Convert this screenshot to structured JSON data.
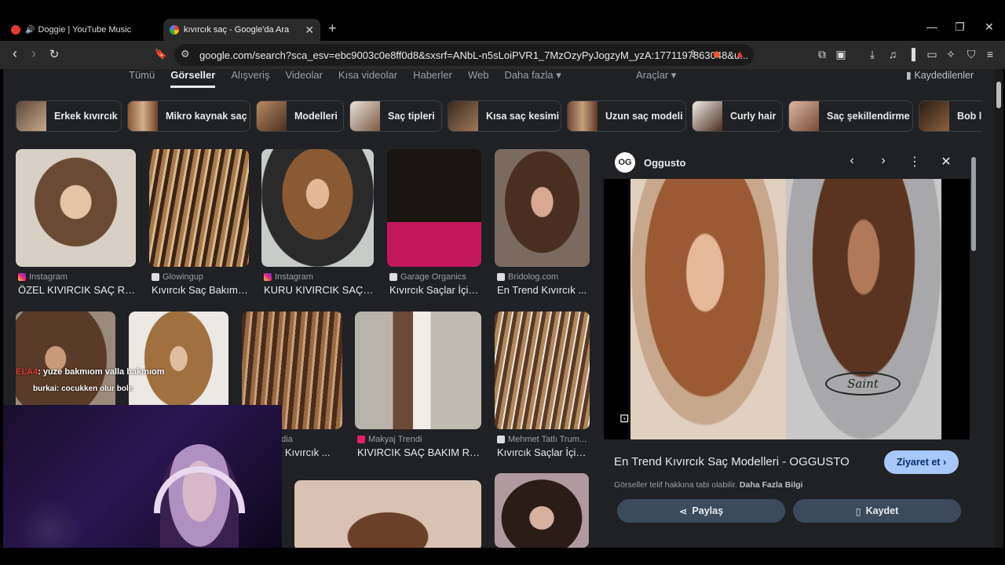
{
  "tabs": [
    {
      "title": "Doggie | YouTube Music",
      "active": false
    },
    {
      "title": "kıvırcık saç - Google'da Ara",
      "active": true
    }
  ],
  "address_bar": {
    "url": "google.com/search?sca_esv=ebc9003c0e8ff0d8&sxsrf=ANbL-n5sLoiPVR1_7MzOzyPyJogzyM_yzA:1771197863048&u..."
  },
  "filters": {
    "items": [
      "Tümü",
      "Görseller",
      "Alışveriş",
      "Videolar",
      "Kısa videolar",
      "Haberler",
      "Web",
      "Daha fazla ▾"
    ],
    "active": "Görseller",
    "tools": "Araçlar ▾",
    "saved": "Kaydedilenler"
  },
  "chips": [
    "Erkek kıvırcık",
    "Mikro kaynak saç",
    "Modelleri",
    "Saç tipleri",
    "Kısa saç kesimi",
    "Uzun saç modeli",
    "Curly hair",
    "Saç şekillendirme",
    "Bob l"
  ],
  "results": [
    {
      "source": "Instagram",
      "title": "ÖZEL KIVIRCIK SAÇ RE..."
    },
    {
      "source": "Glowingup",
      "title": "Kıvırcık Saç Bakımı..."
    },
    {
      "source": "Instagram",
      "title": "KURU KIVIRCIK SAÇ ..."
    },
    {
      "source": "Garage Organics",
      "title": "Kıvırcık Saçlar İçin..."
    },
    {
      "source": "Bridolog.com",
      "title": "En Trend Kıvırcık ..."
    },
    {
      "source": "edia",
      "title": "a Kıvırcık ..."
    },
    {
      "source": "Makyaj Trendi",
      "title": "KIVIRCIK SAÇ BAKIM RU..."
    },
    {
      "source": "Mehmet Tatlı Trum...",
      "title": "Kıvırcık Saçlar İçin..."
    }
  ],
  "panel": {
    "site_logo": "OG",
    "site_name": "Oggusto",
    "title": "En Trend Kıvırcık Saç Modelleri - OGGUSTO",
    "visit": "Ziyaret et",
    "copyright": "Görseller telif hakkına tabi olabilir.",
    "learn_more": "Daha Fazla Bilgi",
    "share": "Paylaş",
    "save": "Kaydet",
    "hoodie_text": "Saint"
  },
  "chat": [
    {
      "user": "ELA4",
      "message": ": yuze bakmıom valla bakmıom"
    },
    {
      "user": "burkai",
      "message": ": cocukken olur bole"
    }
  ]
}
